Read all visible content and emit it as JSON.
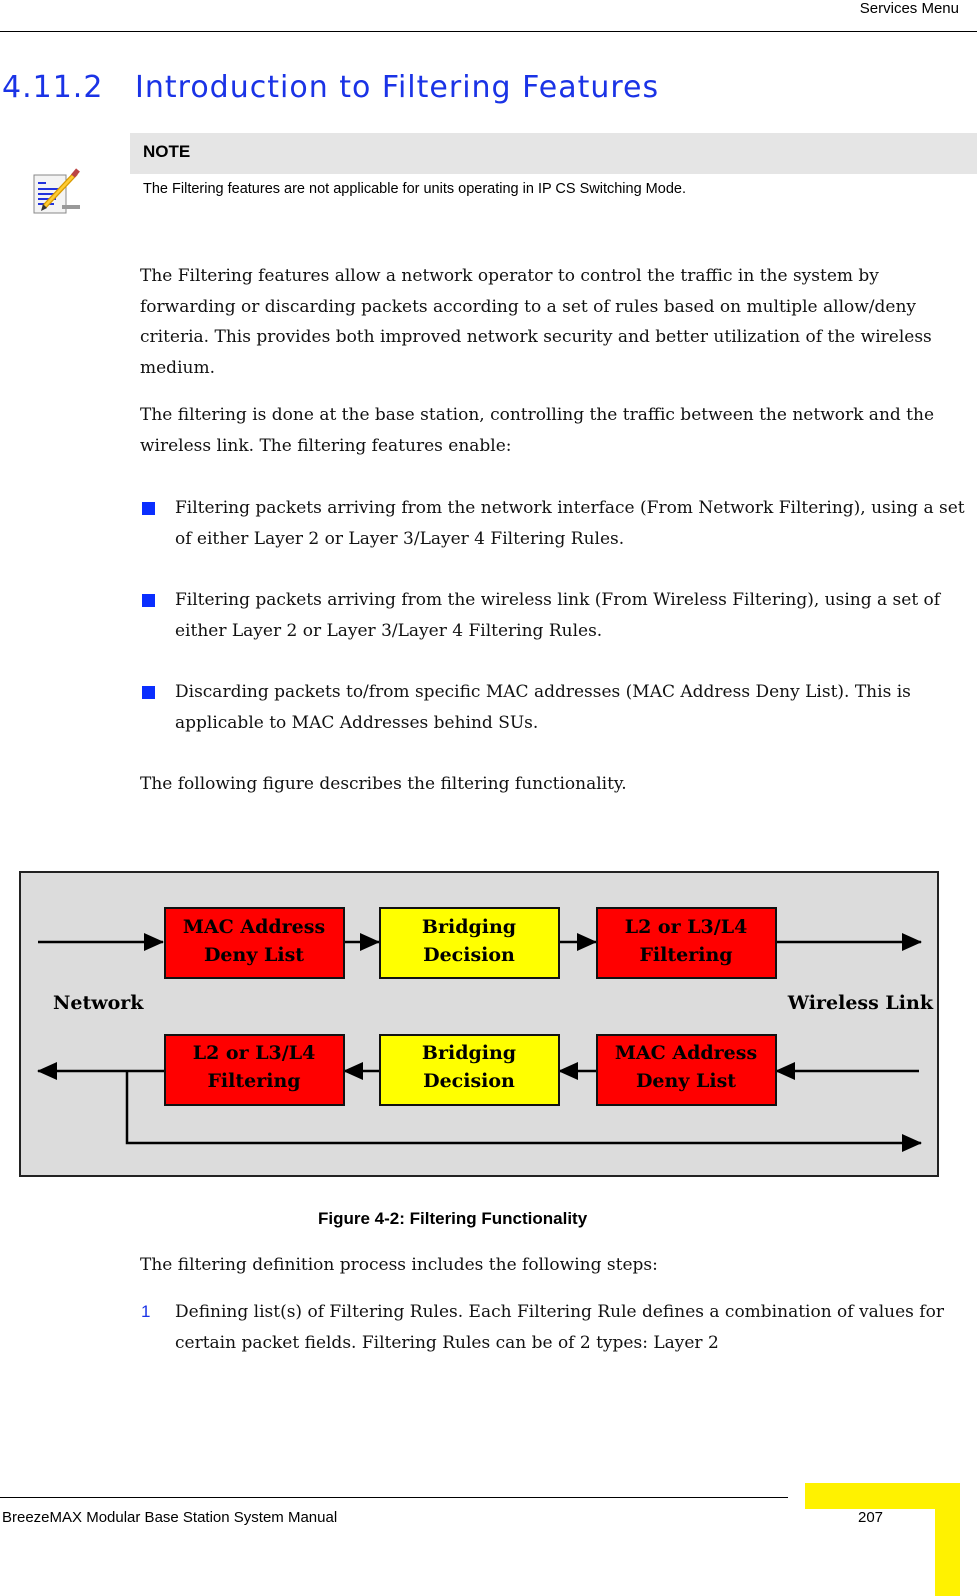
{
  "header": {
    "running_title": "Services Menu"
  },
  "section": {
    "number": "4.11.2",
    "title": "Introduction to Filtering Features"
  },
  "note": {
    "icon": "note-pencil-icon",
    "title": "NOTE",
    "text": "The Filtering features are not applicable for units operating in IP CS Switching Mode."
  },
  "paragraphs": [
    "The Filtering features allow a network operator to control the traffic in the system by forwarding or discarding packets according to a set of rules based on multiple allow/deny criteria. This provides both improved network security and better utilization of the wireless medium.",
    "The filtering is done at the base station, controlling the traffic between the network and the wireless link. The filtering features enable:"
  ],
  "bullets": [
    "Filtering packets arriving from the network interface (From Network Filtering), using a set of either Layer 2 or Layer 3/Layer 4 Filtering Rules.",
    "Filtering packets arriving from the wireless link (From Wireless Filtering), using a set of either Layer 2 or Layer 3/Layer 4 Filtering Rules.",
    "Discarding packets to/from specific MAC addresses (MAC Address Deny List). This is applicable to MAC Addresses behind SUs."
  ],
  "figure_intro": "The following figure describes the filtering functionality.",
  "figure": {
    "caption": "Figure 4-2: Filtering Functionality",
    "left_label": "Network",
    "right_label": "Wireless Link",
    "colors": {
      "background": "#dcdcdc",
      "filter_box": "#ff0000",
      "bridge_box": "#ffff00"
    },
    "top_row": [
      {
        "line1": "MAC Address",
        "line2": "Deny List",
        "kind": "filter"
      },
      {
        "line1": "Bridging",
        "line2": "Decision",
        "kind": "bridge"
      },
      {
        "line1": "L2 or L3/L4",
        "line2": "Filtering",
        "kind": "filter"
      }
    ],
    "bottom_row": [
      {
        "line1": "L2 or L3/L4",
        "line2": "Filtering",
        "kind": "filter"
      },
      {
        "line1": "Bridging",
        "line2": "Decision",
        "kind": "bridge"
      },
      {
        "line1": "MAC Address",
        "line2": "Deny List",
        "kind": "filter"
      }
    ]
  },
  "steps_intro": "The filtering definition process includes the following steps:",
  "steps": [
    {
      "number": "1",
      "text": "Defining list(s) of Filtering Rules. Each Filtering Rule defines a combination of values for certain packet fields. Filtering Rules can be of 2 types: Layer 2"
    }
  ],
  "footer": {
    "manual_title": "BreezeMAX Modular Base Station System Manual",
    "page_number": "207"
  }
}
